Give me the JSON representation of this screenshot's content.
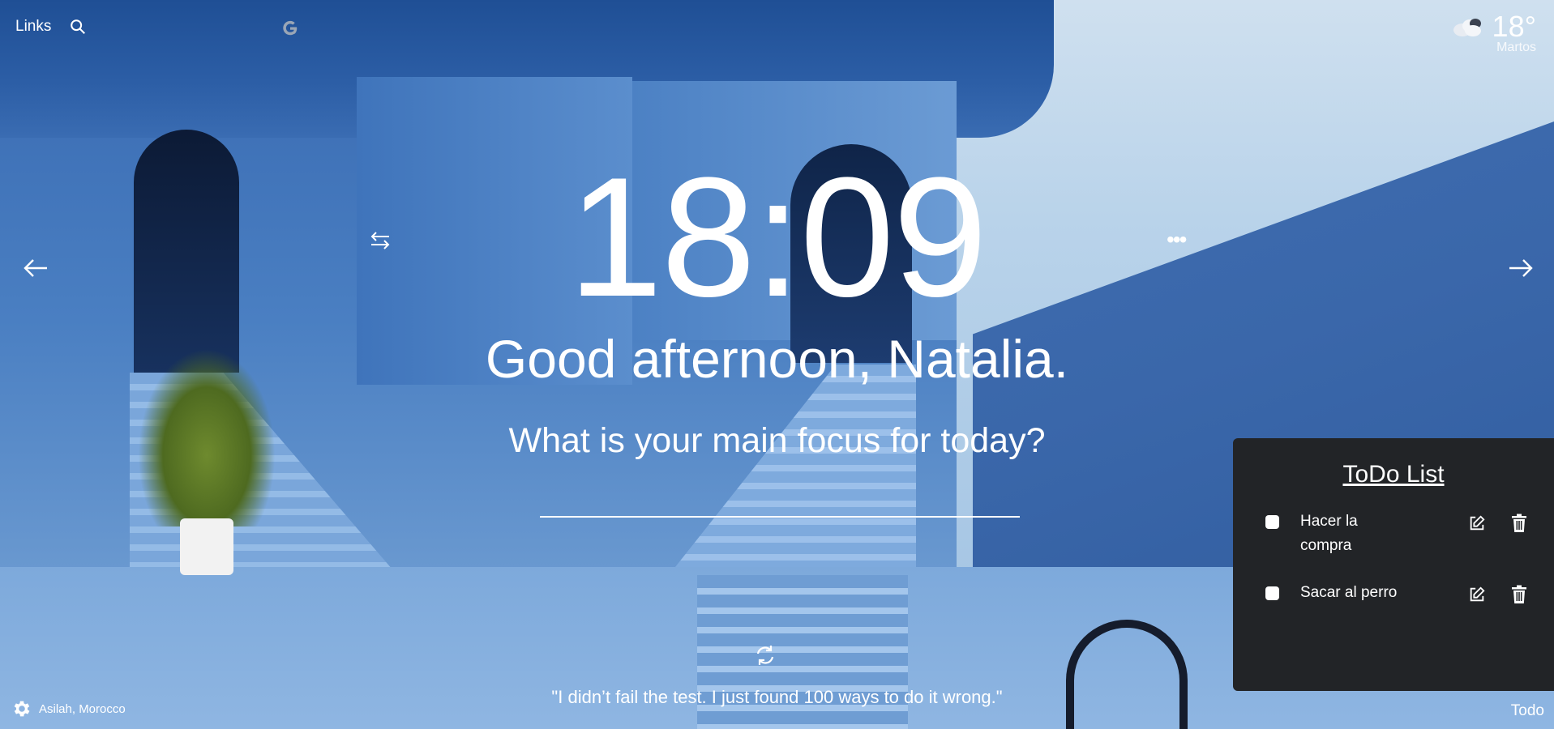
{
  "topbar": {
    "links_label": "Links",
    "search_icon": "search-icon",
    "google_icon": "google-icon"
  },
  "weather": {
    "icon": "cloud-icon",
    "temperature": "18°",
    "location": "Martos"
  },
  "navigation": {
    "prev_icon": "arrow-left-icon",
    "next_icon": "arrow-right-icon",
    "swap_icon": "swap-icon",
    "more_icon": "more-dots-icon"
  },
  "clock": {
    "time": "18:09"
  },
  "greeting": {
    "text": "Good afternoon, Natalia."
  },
  "focus": {
    "question": "What is your main focus for today?",
    "value": ""
  },
  "quote": {
    "refresh_icon": "refresh-icon",
    "text": "\"I didn’t fail the test. I just found 100 ways to do it wrong.\""
  },
  "footer": {
    "settings_icon": "gear-icon",
    "photo_location": "Asilah, Morocco",
    "todo_label": "Todo"
  },
  "todo": {
    "title": "ToDo List",
    "items": [
      {
        "text": "Hacer la compra",
        "checked": false
      },
      {
        "text": "Sacar al perro",
        "checked": false
      }
    ]
  },
  "colors": {
    "panel_bg": "#222427",
    "text": "#ffffff"
  }
}
